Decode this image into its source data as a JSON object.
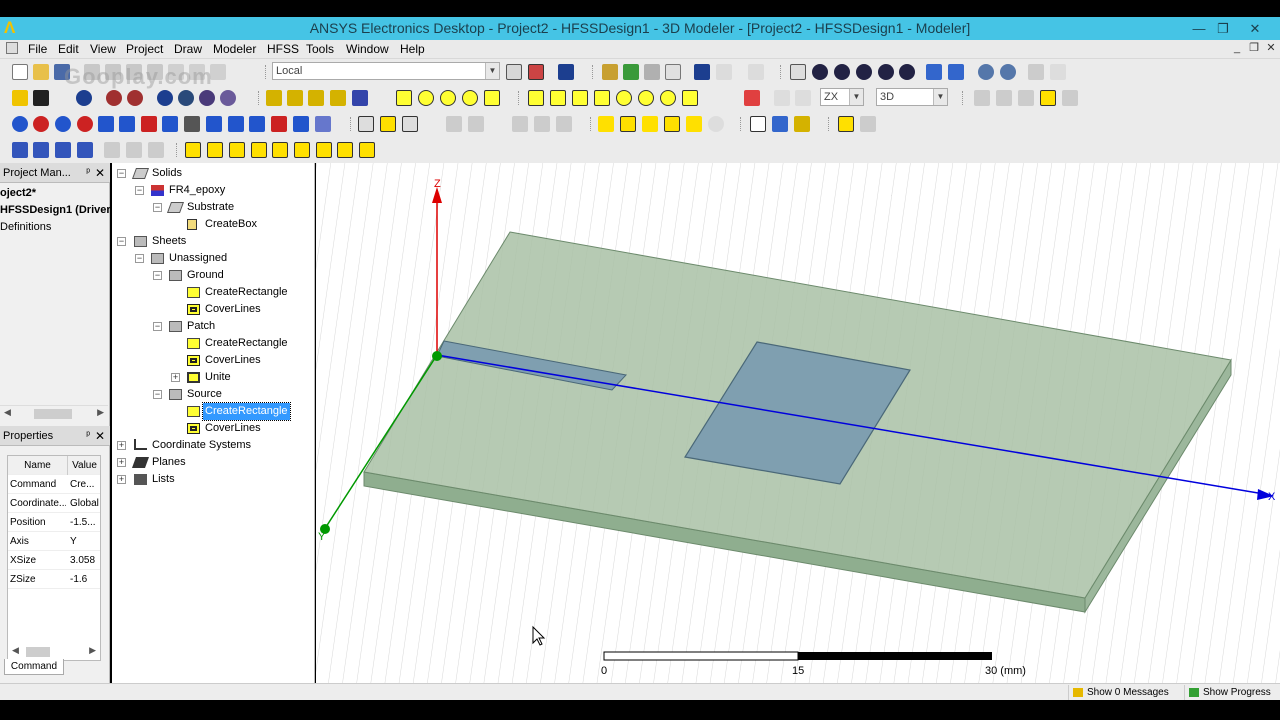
{
  "window": {
    "title": "ANSYS Electronics Desktop - Project2 - HFSSDesign1 - 3D Modeler - [Project2 - HFSSDesign1 - Modeler]",
    "minimize_glyph": "—",
    "restore_glyph": "❐",
    "close_glyph": "✕"
  },
  "menu": [
    "File",
    "Edit",
    "View",
    "Project",
    "Draw",
    "Modeler",
    "HFSS",
    "Tools",
    "Window",
    "Help"
  ],
  "mdi_controls": [
    "_",
    "❐",
    "✕"
  ],
  "toolbar": {
    "coordinate_system": "Local",
    "plane": "ZX",
    "view_mode": "3D"
  },
  "project_manager": {
    "header": "Project Man...",
    "pin": "ᵖ",
    "close": "✕",
    "items": [
      "oject2*",
      "HFSSDesign1 (Driver",
      "Definitions"
    ]
  },
  "properties": {
    "header": "Properties",
    "columns": [
      "Name",
      "Value"
    ],
    "rows": [
      {
        "name": "Command",
        "value": "Cre..."
      },
      {
        "name": "Coordinate...",
        "value": "Global"
      },
      {
        "name": "Position",
        "value": "-1.5..."
      },
      {
        "name": "Axis",
        "value": "Y"
      },
      {
        "name": "XSize",
        "value": "3.058"
      },
      {
        "name": "ZSize",
        "value": "-1.6"
      }
    ],
    "tab": "Command"
  },
  "tree": {
    "solids": "Solids",
    "fr4": "FR4_epoxy",
    "substrate": "Substrate",
    "createbox": "CreateBox",
    "sheets": "Sheets",
    "unassigned": "Unassigned",
    "ground": "Ground",
    "ground_cr": "CreateRectangle",
    "ground_cl": "CoverLines",
    "patch": "Patch",
    "patch_cr": "CreateRectangle",
    "patch_cl": "CoverLines",
    "unite": "Unite",
    "source": "Source",
    "source_cr": "CreateRectangle",
    "source_cl": "CoverLines",
    "coord_systems": "Coordinate Systems",
    "planes": "Planes",
    "lists": "Lists"
  },
  "viewport": {
    "axis_z": "Z",
    "axis_y": "Y",
    "axis_x": "X",
    "scale_labels": [
      "0",
      "15",
      "30 (mm)"
    ],
    "watermark": "Gooplay.com"
  },
  "status": {
    "messages": "Show 0 Messages",
    "progress": "Show Progress"
  },
  "colors": {
    "titlebar": "#45c4e5",
    "substrate": "#8fae8f",
    "axis_x": "#0000dd",
    "axis_y": "#009900",
    "axis_z": "#dd0000",
    "selection": "#3399ff"
  }
}
